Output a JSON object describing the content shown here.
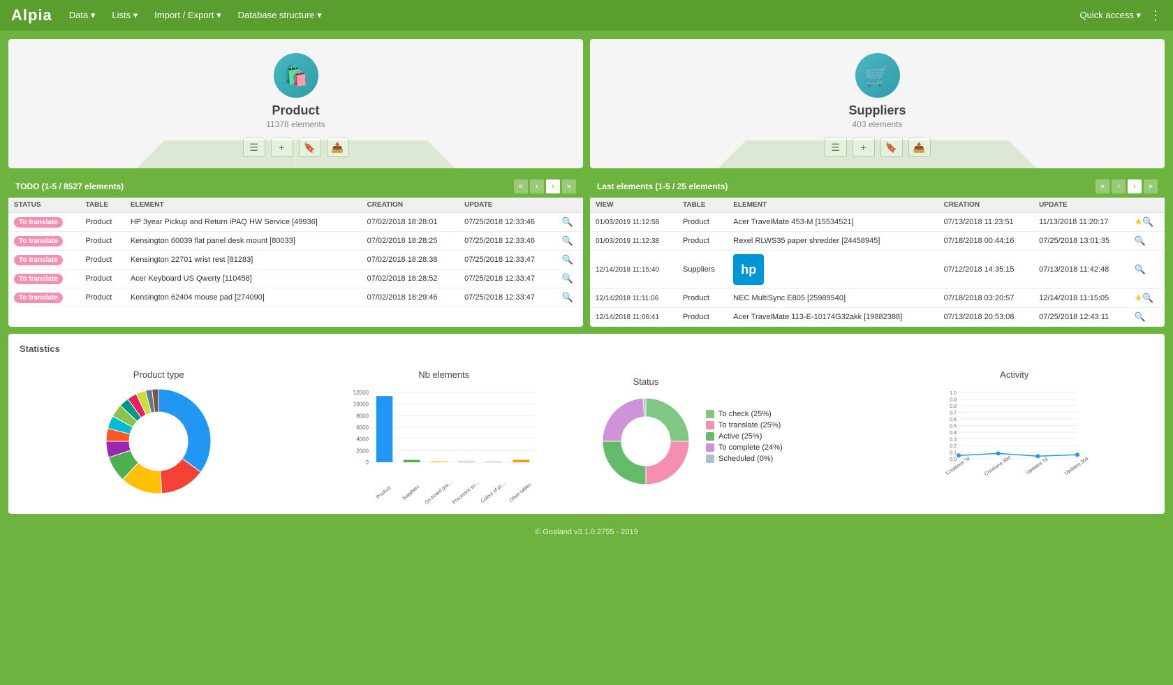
{
  "navbar": {
    "logo": "Alpia",
    "menus": [
      "Data",
      "Lists",
      "Import / Export",
      "Database structure"
    ],
    "quick_access": "Quick access",
    "more_icon": "⋮"
  },
  "product_card": {
    "title": "Product",
    "count": "11378 elements",
    "icon": "🛍️",
    "actions": [
      "list-icon",
      "add-icon",
      "bookmark-icon",
      "export-icon"
    ]
  },
  "suppliers_card": {
    "title": "Suppliers",
    "count": "403 elements",
    "icon": "🛒",
    "actions": [
      "list-icon",
      "add-icon",
      "bookmark-icon",
      "export-icon"
    ]
  },
  "todo_panel": {
    "header": "TODO (1-5 / 8527 elements)",
    "columns": [
      "STATUS",
      "TABLE",
      "ELEMENT",
      "CREATION",
      "UPDATE"
    ],
    "rows": [
      {
        "status": "To translate",
        "table": "Product",
        "element": "HP 3year Pickup and Return iPAQ HW Service [49936]",
        "creation": "07/02/2018 18:28:01",
        "update": "07/25/2018 12:33:46"
      },
      {
        "status": "To translate",
        "table": "Product",
        "element": "Kensington 60039 flat panel desk mount [80033]",
        "creation": "07/02/2018 18:28:25",
        "update": "07/25/2018 12:33:46"
      },
      {
        "status": "To translate",
        "table": "Product",
        "element": "Kensington 22701 wrist rest [81283]",
        "creation": "07/02/2018 18:28:38",
        "update": "07/25/2018 12:33:47"
      },
      {
        "status": "To translate",
        "table": "Product",
        "element": "Acer Keyboard US Qwerty [110458]",
        "creation": "07/02/2018 18:28:52",
        "update": "07/25/2018 12:33:47"
      },
      {
        "status": "To translate",
        "table": "Product",
        "element": "Kensington 62404 mouse pad [274090]",
        "creation": "07/02/2018 18:29:46",
        "update": "07/25/2018 12:33:47"
      }
    ]
  },
  "last_panel": {
    "header": "Last elements (1-5 / 25 elements)",
    "columns": [
      "VIEW",
      "TABLE",
      "ELEMENT",
      "CREATION",
      "UPDATE"
    ],
    "rows": [
      {
        "view": "01/03/2019 11:12:58",
        "table": "Product",
        "element": "Acer TravelMate 453-M [15534521]",
        "creation": "07/13/2018 11:23:51",
        "update": "11/13/2018 11:20:17",
        "star": true
      },
      {
        "view": "01/03/2019 11:12:38",
        "table": "Product",
        "element": "Rexel RLWS35 paper shredder [24458945]",
        "creation": "07/18/2018 00:44:16",
        "update": "07/25/2018 13:01:35",
        "star": false
      },
      {
        "view": "12/14/2018 11:15:40",
        "table": "Suppliers",
        "element": "HP",
        "creation": "07/12/2018 14:35:15",
        "update": "07/13/2018 11:42:48",
        "hp_logo": true
      },
      {
        "view": "12/14/2018 11:11:06",
        "table": "Product",
        "element": "NEC MultiSync E805 [25989540]",
        "creation": "07/18/2018 03:20:57",
        "update": "12/14/2018 11:15:05",
        "star": true
      },
      {
        "view": "12/14/2018 11:06:41",
        "table": "Product",
        "element": "Acer TravelMate 113-E-10174G32akk [19882388]",
        "creation": "07/13/2018 20:53:08",
        "update": "07/25/2018 12:43:11",
        "star": false
      }
    ]
  },
  "statistics": {
    "title": "Statistics",
    "charts": {
      "product_type": {
        "title": "Product type",
        "segments": [
          {
            "color": "#2196F3",
            "percent": 35
          },
          {
            "color": "#F44336",
            "percent": 14
          },
          {
            "color": "#FFC107",
            "percent": 13
          },
          {
            "color": "#4CAF50",
            "percent": 8
          },
          {
            "color": "#9C27B0",
            "percent": 5
          },
          {
            "color": "#FF5722",
            "percent": 4
          },
          {
            "color": "#00BCD4",
            "percent": 4
          },
          {
            "color": "#8BC34A",
            "percent": 4
          },
          {
            "color": "#009688",
            "percent": 3
          },
          {
            "color": "#E91E63",
            "percent": 3
          },
          {
            "color": "#CDDC39",
            "percent": 3
          },
          {
            "color": "#607D8B",
            "percent": 2
          },
          {
            "color": "#795548",
            "percent": 2
          }
        ]
      },
      "nb_elements": {
        "title": "Nb elements",
        "bars": [
          {
            "label": "Product",
            "value": 11378,
            "color": "#2196F3"
          },
          {
            "label": "Suppliers",
            "value": 403,
            "color": "#4CAF50"
          },
          {
            "label": "On-board graphics adap...",
            "value": 150,
            "color": "#FFC107"
          },
          {
            "label": "Processor socket",
            "value": 80,
            "color": "#F44336"
          },
          {
            "label": "Colour of product",
            "value": 50,
            "color": "#9C27B0"
          },
          {
            "label": "Other tables",
            "value": 420,
            "color": "#FF9800"
          }
        ],
        "max": 12000,
        "y_labels": [
          "12000",
          "10000",
          "8000",
          "6000",
          "4000",
          "2000",
          "0"
        ]
      },
      "status": {
        "title": "Status",
        "segments": [
          {
            "color": "#81C784",
            "label": "To check (25%)",
            "percent": 25
          },
          {
            "color": "#F48FB1",
            "label": "To translate (25%)",
            "percent": 25
          },
          {
            "color": "#66BB6A",
            "label": "Active (25%)",
            "percent": 25
          },
          {
            "color": "#CE93D8",
            "label": "To complete (24%)",
            "percent": 24
          },
          {
            "color": "#B0BEC5",
            "label": "Scheduled (0%)",
            "percent": 1
          }
        ]
      },
      "activity": {
        "title": "Activity",
        "x_labels": [
          "Creations 7d",
          "Creations 30d",
          "Updates 7d",
          "Updates 30d"
        ],
        "y_labels": [
          "1.0",
          "0.9",
          "0.8",
          "0.7",
          "0.6",
          "0.5",
          "0.4",
          "0.3",
          "0.2",
          "0.1",
          "0"
        ],
        "points": [
          0.05,
          0.08,
          0.04,
          0.06
        ]
      }
    }
  },
  "footer": {
    "text": "© Goaland v3.1.0.2755 - 2019"
  }
}
